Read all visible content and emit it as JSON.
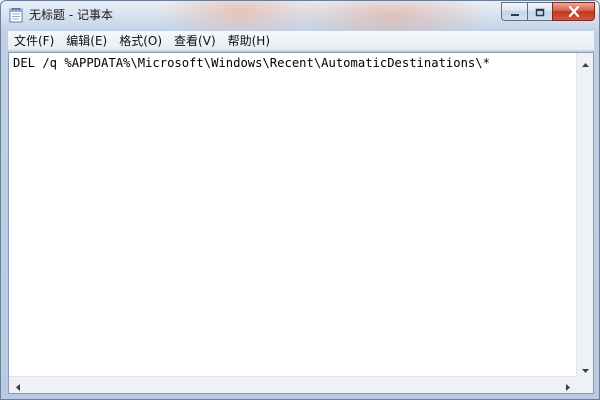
{
  "window": {
    "title": "无标题 - 记事本",
    "icon": "notepad-icon"
  },
  "caption_buttons": {
    "minimize": "minimize-icon",
    "maximize": "maximize-icon",
    "close": "close-icon"
  },
  "menu": {
    "items": [
      {
        "label": "文件(F)"
      },
      {
        "label": "编辑(E)"
      },
      {
        "label": "格式(O)"
      },
      {
        "label": "查看(V)"
      },
      {
        "label": "帮助(H)"
      }
    ]
  },
  "editor": {
    "content": "DEL /q %APPDATA%\\Microsoft\\Windows\\Recent\\AutomaticDestinations\\*"
  },
  "colors": {
    "title_bar": "#bfd0e6",
    "close_button": "#c9452f",
    "editor_bg": "#ffffff"
  }
}
